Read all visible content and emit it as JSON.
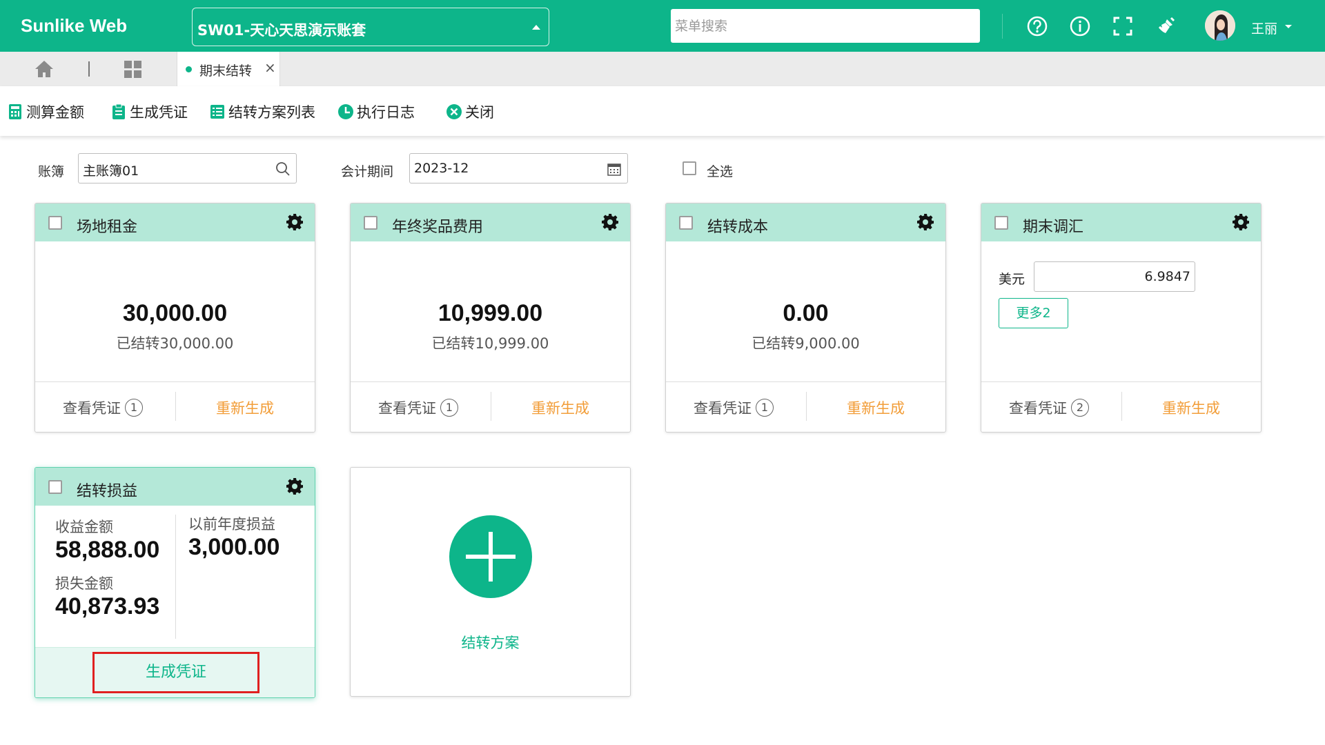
{
  "header": {
    "brand": "Sunlike Web",
    "ledger_set": "SW01-天心天思演示账套",
    "search_placeholder": "菜单搜索",
    "user_name": "王丽",
    "icons": [
      "help-icon",
      "info-icon",
      "fullscreen-icon",
      "clean-icon"
    ]
  },
  "tabs": {
    "active_label": "期末结转",
    "close_glyph": "×"
  },
  "toolbar": {
    "calc": "测算金额",
    "generate": "生成凭证",
    "plan_list": "结转方案列表",
    "log": "执行日志",
    "close": "关闭"
  },
  "filters": {
    "book_label": "账簿",
    "book_value": "主账簿01",
    "period_label": "会计期间",
    "period_value": "2023-12",
    "select_all_label": "全选"
  },
  "cards": [
    {
      "title": "场地租金",
      "amount": "30,000.00",
      "sub": "已结转30,000.00",
      "view": "查看凭证",
      "count": "1",
      "regen": "重新生成"
    },
    {
      "title": "年终奖品费用",
      "amount": "10,999.00",
      "sub": "已结转10,999.00",
      "view": "查看凭证",
      "count": "1",
      "regen": "重新生成"
    },
    {
      "title": "结转成本",
      "amount": "0.00",
      "sub": "已结转9,000.00",
      "view": "查看凭证",
      "count": "1",
      "regen": "重新生成"
    },
    {
      "title": "期末调汇",
      "currency_label": "美元",
      "rate": "6.9847",
      "more": "更多2",
      "view": "查看凭证",
      "count": "2",
      "regen": "重新生成"
    }
  ],
  "pl_card": {
    "title": "结转损益",
    "income_label": "收益金额",
    "income_value": "58,888.00",
    "loss_label": "损失金额",
    "loss_value": "40,873.93",
    "prior_label": "以前年度损益",
    "prior_value": "3,000.00",
    "generate": "生成凭证"
  },
  "add_card": {
    "label": "结转方案"
  },
  "colors": {
    "primary": "#0db58a",
    "card_header": "#b4e8d8",
    "regen": "#f29d38",
    "highlight": "#e02020"
  }
}
